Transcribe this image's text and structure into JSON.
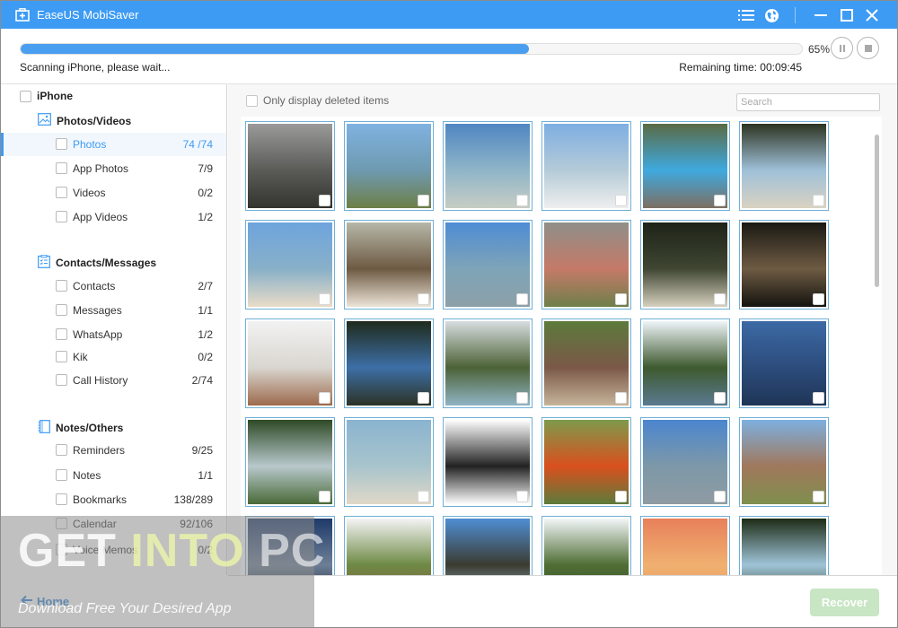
{
  "window": {
    "title": "EaseUS MobiSaver",
    "controls": {
      "menu_icon": "list-icon",
      "language_icon": "globe-icon",
      "minimize_icon": "minimize-icon",
      "maximize_icon": "maximize-icon",
      "close_icon": "close-icon"
    }
  },
  "scan": {
    "progress_percent": 65,
    "progress_label": "65%",
    "status_text": "Scanning iPhone, please wait...",
    "remaining_time": "Remaining time: 00:09:45",
    "pause_icon": "pause-icon",
    "stop_icon": "stop-icon"
  },
  "sidebar": {
    "root_label": "iPhone",
    "groups": [
      {
        "title": "Photos/Videos",
        "icon": "image-icon",
        "items": [
          {
            "label": "Photos",
            "count": "74 /74",
            "selected": true
          },
          {
            "label": "App Photos",
            "count": "7/9"
          },
          {
            "label": "Videos",
            "count": "0/2"
          },
          {
            "label": "App Videos",
            "count": "1/2"
          }
        ]
      },
      {
        "title": "Contacts/Messages",
        "icon": "clipboard-list-icon",
        "items": [
          {
            "label": "Contacts",
            "count": "2/7"
          },
          {
            "label": "Messages",
            "count": "1/1"
          },
          {
            "label": "WhatsApp",
            "count": "1/2"
          },
          {
            "label": "Kik",
            "count": "0/2"
          },
          {
            "label": "Call History",
            "count": "2/74"
          }
        ]
      },
      {
        "title": "Notes/Others",
        "icon": "notebook-icon",
        "items": [
          {
            "label": "Reminders",
            "count": "9/25"
          },
          {
            "label": "Notes",
            "count": "1/1"
          },
          {
            "label": "Bookmarks",
            "count": "138/289"
          },
          {
            "label": "Calendar",
            "count": "92/106"
          },
          {
            "label": "Voice Memos",
            "count": "0/2"
          }
        ]
      }
    ],
    "home_label": "Home"
  },
  "main": {
    "filter_label": "Only display deleted items",
    "search_placeholder": "Search",
    "recover_label": "Recover",
    "thumbnails": [
      {
        "subject": "stone ruin under cloudy sky",
        "colors": [
          "#9a9a9a",
          "#5b5b58",
          "#33332f"
        ]
      },
      {
        "subject": "island and rocky shore",
        "colors": [
          "#7fb2e0",
          "#6e9ab0",
          "#6d7f47"
        ]
      },
      {
        "subject": "island in turquoise sea",
        "colors": [
          "#4f86c2",
          "#8fb5c8",
          "#c7cdc4"
        ]
      },
      {
        "subject": "beach with longtail boat",
        "colors": [
          "#7eaee2",
          "#b4cbd8",
          "#eeeeee"
        ]
      },
      {
        "subject": "resort pool with loungers",
        "colors": [
          "#5a6b45",
          "#3fa9df",
          "#7c6f62"
        ]
      },
      {
        "subject": "hammock on tropical beach",
        "colors": [
          "#2d3421",
          "#9fc0d8",
          "#d9d2c2"
        ]
      },
      {
        "subject": "couple sitting on beach",
        "colors": [
          "#6ea4de",
          "#88b0c8",
          "#e9dcc8"
        ]
      },
      {
        "subject": "balcony overlooking sea",
        "colors": [
          "#b6b7a8",
          "#6e5a43",
          "#ece4d8"
        ]
      },
      {
        "subject": "palm tree by the sea",
        "colors": [
          "#4e8cd4",
          "#7ea4b8",
          "#8ca0a8"
        ]
      },
      {
        "subject": "child on rocks",
        "colors": [
          "#8f8f89",
          "#c57a68",
          "#6f7f4a"
        ]
      },
      {
        "subject": "beach at night",
        "colors": [
          "#1e2318",
          "#3f4632",
          "#d6d0bf"
        ]
      },
      {
        "subject": "sunset silhouettes",
        "colors": [
          "#1a1914",
          "#6e5b43",
          "#14130f"
        ]
      },
      {
        "subject": "boat on misty beach",
        "colors": [
          "#f2f2f2",
          "#d9d6d0",
          "#9c6a4c"
        ]
      },
      {
        "subject": "people near waterfall",
        "colors": [
          "#1f2a1c",
          "#3d6fa6",
          "#2c3326"
        ]
      },
      {
        "subject": "rocky island coastline",
        "colors": [
          "#d7dde0",
          "#4c6236",
          "#8fb4c4"
        ]
      },
      {
        "subject": "garden hut",
        "colors": [
          "#5c7a3c",
          "#7b5848",
          "#c6b49a"
        ]
      },
      {
        "subject": "trees reflected in lake",
        "colors": [
          "#eef4f8",
          "#3e5a2f",
          "#5a7a90"
        ]
      },
      {
        "subject": "blue lake at dusk",
        "colors": [
          "#3c6aa5",
          "#2c4c7c",
          "#1f3557"
        ]
      },
      {
        "subject": "misty river gorge",
        "colors": [
          "#2e4a26",
          "#b8c8cc",
          "#496a38"
        ]
      },
      {
        "subject": "woman on beach",
        "colors": [
          "#8ab4d0",
          "#a8c4cc",
          "#e0d8c8"
        ]
      },
      {
        "subject": "woman in dress",
        "colors": [
          "#ffffff",
          "#222222",
          "#ffffff"
        ]
      },
      {
        "subject": "orange bird on branch",
        "colors": [
          "#7e9a4c",
          "#d9501e",
          "#5d7a3a"
        ]
      },
      {
        "subject": "palm tree and sky",
        "colors": [
          "#4b86cf",
          "#7d98a8",
          "#8f9ba2"
        ]
      },
      {
        "subject": "garden fountain urn",
        "colors": [
          "#7eb0e0",
          "#a0785c",
          "#7f8f4e"
        ]
      },
      {
        "subject": "dramatic cloudy night sky",
        "colors": [
          "#1e3a6a",
          "#6d7f96",
          "#0f1d33"
        ]
      },
      {
        "subject": "thatched hut in trees",
        "colors": [
          "#f4f4f4",
          "#6e8a45",
          "#8a5b3a"
        ]
      },
      {
        "subject": "limestone cliffs beach",
        "colors": [
          "#4f8ed4",
          "#3b3b30",
          "#9fc0d0"
        ]
      },
      {
        "subject": "jungle lagoon",
        "colors": [
          "#f2f6f8",
          "#4f6d34",
          "#3a5428"
        ]
      },
      {
        "subject": "orange sunset over sea",
        "colors": [
          "#e8805a",
          "#f0b070",
          "#e89a60"
        ]
      },
      {
        "subject": "cascading waterfall",
        "colors": [
          "#1e2c16",
          "#9fc4d8",
          "#2a3c1e"
        ]
      }
    ]
  },
  "watermark": {
    "title_parts": [
      "GET ",
      "INTO ",
      "PC"
    ],
    "subtitle": "Download Free Your Desired App"
  }
}
